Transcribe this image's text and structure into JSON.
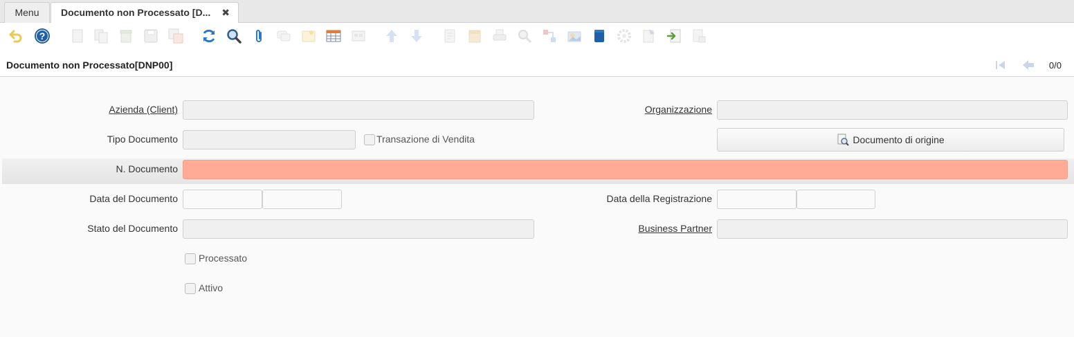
{
  "tabs": {
    "menu_label": "Menu",
    "active_label": "Documento non Processato [D...",
    "close_glyph": "✖"
  },
  "toolbar": {
    "icons": [
      "undo-icon",
      "help-icon",
      "new-icon",
      "copy-icon",
      "delete-icon",
      "save-icon",
      "save-new-icon",
      "refresh-icon",
      "find-icon",
      "attachment-icon",
      "chat-icon",
      "product-info-icon",
      "grid-toggle-icon",
      "detail-record-icon",
      "previous-record-icon",
      "next-record-icon",
      "report-icon",
      "archive-icon",
      "print-icon",
      "zoom-across-icon",
      "workflow-icon",
      "export-icon",
      "request-icon",
      "process-icon",
      "customize-icon",
      "import-icon",
      "quick-form-icon"
    ]
  },
  "header": {
    "title": "Documento non Processato[DNP00]",
    "counter": "0/0"
  },
  "form": {
    "client_label": "Azienda (Client)",
    "org_label": "Organizzazione",
    "doctype_label": "Tipo Documento",
    "sales_tx_label": "Transazione di Vendita",
    "source_doc_button": "Documento di origine",
    "docno_label": "N. Documento",
    "doc_date_label": "Data del Documento",
    "acct_date_label": "Data della Registrazione",
    "status_label": "Stato del Documento",
    "bpartner_label": "Business Partner",
    "processed_label": "Processato",
    "active_label": "Attivo"
  },
  "colors": {
    "mandatory": "#ffab96",
    "accent_blue": "#1f5fa8"
  }
}
